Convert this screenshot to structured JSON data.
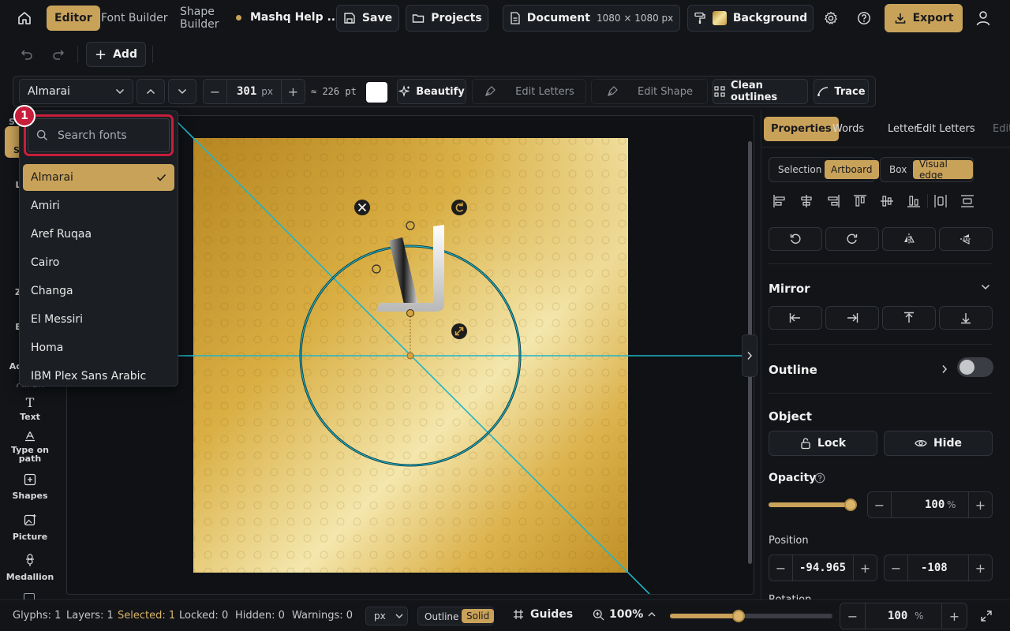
{
  "topbar": {
    "tabs": [
      "Editor",
      "Font Builder",
      "Shape Builder"
    ],
    "project_name": "Mashq Help ...",
    "save_label": "Save",
    "projects_label": "Projects",
    "document_label": "Document",
    "document_size": "1080 × 1080 px",
    "background_label": "Background",
    "export_label": "Export"
  },
  "row2": {
    "add_label": "Add"
  },
  "toolbar": {
    "font_name": "Almarai",
    "size_value": "301",
    "size_unit": "px",
    "size_pt": "≈ 226 pt",
    "beautify_label": "Beautify",
    "edit_letters_label": "Edit Letters",
    "edit_shape_label": "Edit Shape",
    "clean_outlines_label": "Clean outlines",
    "trace_label": "Trace"
  },
  "font_dropdown": {
    "badge": "1",
    "search_placeholder": "Search fonts",
    "fonts": [
      "Almarai",
      "Amiri",
      "Aref Ruqaa",
      "Cairo",
      "Changa",
      "El Messiri",
      "Homa",
      "IBM Plex Sans Arabic"
    ],
    "selected": "Almarai"
  },
  "rail": {
    "partial_labels": [
      "S",
      "S",
      "L",
      "I",
      "Z",
      "E",
      "Ad"
    ],
    "create_heading": "CREATE",
    "items": [
      "Text",
      "Type on path",
      "Shapes",
      "Picture",
      "Medallion"
    ]
  },
  "right_panel": {
    "tabs": [
      "Properties",
      "Words",
      "Letter",
      "Edit Letters",
      "Edit"
    ],
    "align_mode": [
      "Selection",
      "Artboard"
    ],
    "align_mode_active": "Artboard",
    "bounds_mode": [
      "Box",
      "Visual edge"
    ],
    "bounds_mode_active": "Visual edge",
    "mirror_heading": "Mirror",
    "outline_heading": "Outline",
    "object_heading": "Object",
    "lock_label": "Lock",
    "hide_label": "Hide",
    "opacity_label": "Opacity",
    "opacity_value": "100",
    "opacity_unit": "%",
    "opacity_level": 1.0,
    "position_label": "Position",
    "position_x": "-94.965",
    "position_y": "-108",
    "rotation_label_partial": "Rotation"
  },
  "status": {
    "glyphs": "Glyphs: 1",
    "layers": "Layers: 1",
    "selected": "Selected: 1",
    "locked": "Locked: 0",
    "hidden": "Hidden: 0",
    "warnings": "Warnings: 0",
    "unit": "px",
    "outline_label": "Outline",
    "solid_label": "Solid",
    "guides_label": "Guides",
    "zoom_value": "100%",
    "zoom_input": "100",
    "zoom_unit": "%",
    "zoom_level": 0.5
  },
  "colors": {
    "accent": "#c9a25a",
    "background": "#121418",
    "guide": "#1fb5c8",
    "badge": "#c81e3c"
  }
}
